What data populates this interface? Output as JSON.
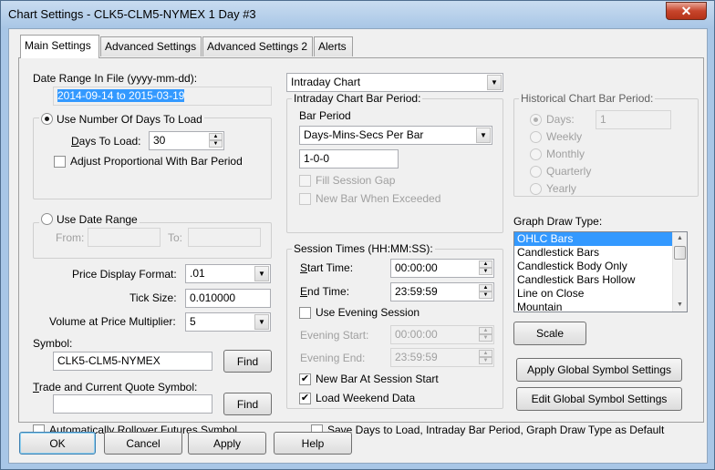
{
  "window": {
    "title": "Chart Settings - CLK5-CLM5-NYMEX  1 Day  #3",
    "close_glyph": "✕"
  },
  "tabs": [
    {
      "label": "Main Settings"
    },
    {
      "label": "Advanced Settings"
    },
    {
      "label": "Advanced Settings 2"
    },
    {
      "label": "Alerts"
    }
  ],
  "date_range": {
    "label": "Date Range In File (yyyy-mm-dd):",
    "value": "2014-09-14 to 2015-03-19"
  },
  "days_group": {
    "radio_label": "Use Number Of Days To Load",
    "days_label": "Days To Load:",
    "days_value": "30",
    "adjust_label": "Adjust Proportional With Bar Period"
  },
  "date_range_group": {
    "radio_label": "Use Date Range",
    "from_label": "From:",
    "to_label": "To:"
  },
  "price_display": {
    "label": "Price Display Format:",
    "value": ".01"
  },
  "tick_size": {
    "label": "Tick Size:",
    "value": "0.010000"
  },
  "volume_multiplier": {
    "label": "Volume at Price Multiplier:",
    "value": "5"
  },
  "symbol": {
    "label": "Symbol:",
    "value": "CLK5-CLM5-NYMEX",
    "find": "Find"
  },
  "trade_symbol": {
    "label": "Trade and Current Quote Symbol:",
    "value": "",
    "find": "Find"
  },
  "rollover": {
    "label": "Automatically Rollover Futures Symbol"
  },
  "chart_type": {
    "value": "Intraday Chart"
  },
  "intraday_period": {
    "caption": "Intraday Chart Bar Period:",
    "bar_period_label": "Bar Period",
    "bar_period_type": "Days-Mins-Secs Per Bar",
    "bar_period_value": "1-0-0",
    "fill_gap_label": "Fill Session Gap",
    "new_bar_exceeded_label": "New Bar When Exceeded"
  },
  "session_times": {
    "caption": "Session Times (HH:MM:SS):",
    "start_label": "Start Time:",
    "start_value": "00:00:00",
    "end_label": "End Time:",
    "end_value": "23:59:59",
    "evening_label": "Use Evening Session",
    "evening_start_label": "Evening Start:",
    "evening_start_value": "00:00:00",
    "evening_end_label": "Evening End:",
    "evening_end_value": "23:59:59",
    "new_bar_label": "New Bar At Session Start",
    "weekend_label": "Load Weekend Data"
  },
  "historical_period": {
    "caption": "Historical Chart Bar Period:",
    "days_label": "Days:",
    "days_value": "1",
    "weekly": "Weekly",
    "monthly": "Monthly",
    "quarterly": "Quarterly",
    "yearly": "Yearly"
  },
  "graph_draw": {
    "label": "Graph Draw Type:",
    "items": [
      "OHLC Bars",
      "Candlestick Bars",
      "Candlestick Body Only",
      "Candlestick Bars Hollow",
      "Line on Close",
      "Mountain"
    ]
  },
  "buttons": {
    "scale": "Scale",
    "apply_global": "Apply Global Symbol Settings",
    "edit_global": "Edit Global Symbol Settings",
    "ok": "OK",
    "cancel": "Cancel",
    "apply": "Apply",
    "help": "Help"
  },
  "save_defaults": {
    "label": "Save Days to Load, Intraday Bar Period, Graph Draw Type as Default"
  },
  "glyphs": {
    "check": "✔",
    "down": "▼",
    "up": "▲"
  }
}
